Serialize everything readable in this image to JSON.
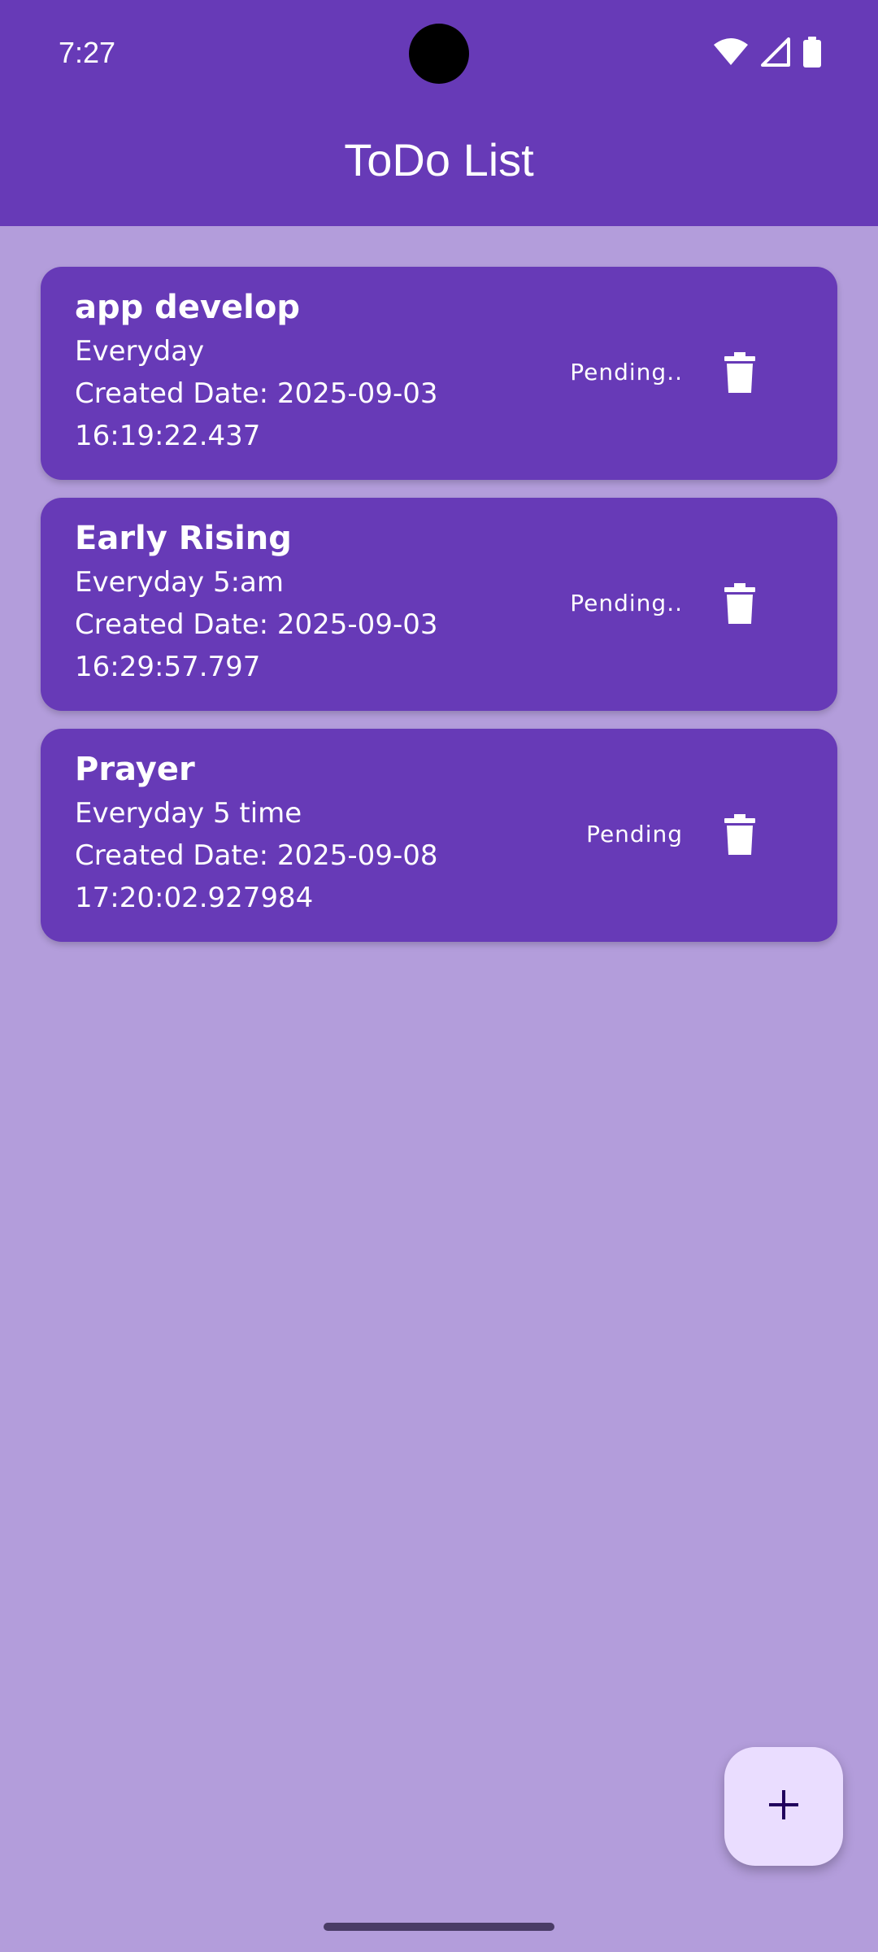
{
  "status_bar": {
    "time": "7:27",
    "icons": [
      "wifi-icon",
      "cell-signal-icon",
      "battery-icon"
    ]
  },
  "app_bar": {
    "title": "ToDo List"
  },
  "todos": [
    {
      "title": "app develop",
      "description": "Everyday",
      "created": "Created Date: 2025-09-03 16:19:22.437",
      "status": "Pending..",
      "delete_icon": "trash-icon"
    },
    {
      "title": "Early Rising",
      "description": "Everyday 5:am",
      "created": "Created Date: 2025-09-03 16:29:57.797",
      "status": "Pending..",
      "delete_icon": "trash-icon"
    },
    {
      "title": "Prayer",
      "description": "Everyday 5 time",
      "created": "Created Date: 2025-09-08 17:20:02.927984",
      "status": "Pending",
      "delete_icon": "trash-icon"
    }
  ],
  "fab": {
    "icon": "plus-icon"
  },
  "colors": {
    "primary": "#673ab7",
    "background": "#b39ddb",
    "fab": "#eaddff",
    "on_primary": "#ffffff"
  }
}
